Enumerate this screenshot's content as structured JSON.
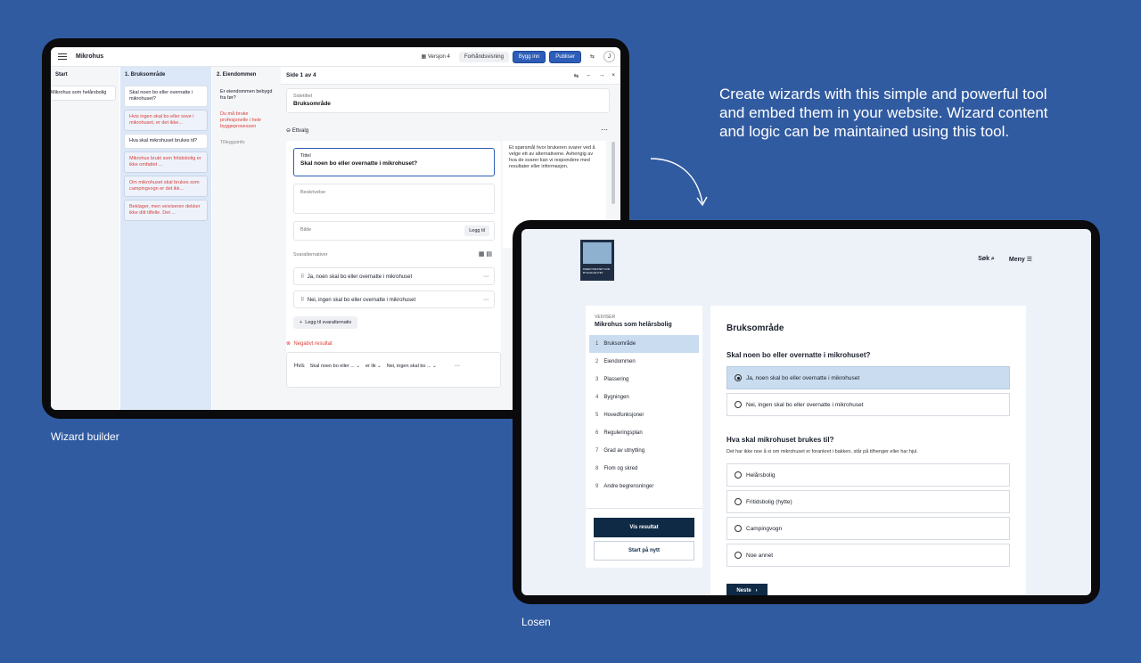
{
  "marketing_text": "Create wizards with this simple and powerful tool and embed them in your website. Wizard content and logic can be maintained using this tool.",
  "captions": {
    "builder": "Wizard builder",
    "losen": "Losen"
  },
  "builder": {
    "title": "Mikrohus",
    "version": "Versjon 4",
    "preview": "Forhåndsvisning",
    "embed": "Bygg inn",
    "publish": "Publiser",
    "avatar": "J",
    "col_start": {
      "head": "Start",
      "cards": [
        "Mikrohus som helårsbolig"
      ]
    },
    "col_bruk": {
      "head": "1.  Bruksområde",
      "cards": [
        {
          "text": "Skal noen bo eller overnatte i mikrohuset?",
          "type": "normal"
        },
        {
          "text": "Hvis ingen skal bo eller sove i mikrohuset, er det ikke...",
          "type": "red"
        },
        {
          "text": "Hva skal mikrohuset brukes til?",
          "type": "normal"
        },
        {
          "text": "Mikrohus brukt som fritidsbolig er ikke omfattet ...",
          "type": "red"
        },
        {
          "text": "Om mikrohuset skal brukes som campingvogn er det ikk...",
          "type": "red"
        },
        {
          "text": "Beklager, men veiviseren dekker ikke ditt tilfelle. Det ...",
          "type": "red"
        }
      ]
    },
    "col_eiend": {
      "head": "2.  Eiendommen",
      "cards": [
        {
          "text": "Er eiendommen bebygd fra før?",
          "type": "normal"
        },
        {
          "text": "Du må bruke profesjonelle i hele byggeprosessen",
          "type": "red"
        },
        {
          "text": "Tilleggsinfo",
          "type": "dim"
        }
      ]
    },
    "panel": {
      "page": "Side 1 av 4",
      "page_title_label": "Sidetittel",
      "page_title": "Bruksområde",
      "block": "Ettvalg",
      "title_label": "Tittel",
      "title_value": "Skal noen bo eller overnatte i mikrohuset?",
      "desc_placeholder": "Beskrivelse",
      "image_label": "Bilde",
      "image_add": "Legg til",
      "answers_label": "Svaralternativer",
      "answers": [
        "Ja, noen skal bo eller overnatte i mikrohuset",
        "Nei, ingen skal bo eller overnatte i mikrohuset"
      ],
      "add_answer": "Legg til svaralternativ",
      "help": "Et spørsmål hvor brukeren svarer ved å velge ett av alternativene. Avhengig av hva de svarer kan vi respondere med resultater eller informasjon.",
      "negative": "Negativt resultat",
      "if": "Hvis",
      "cond_q": "Skal noen bo eller ...",
      "cond_op": "er lik",
      "cond_v": "Nei, ingen skal bo ..."
    }
  },
  "losen": {
    "search": "Søk",
    "menu": "Meny",
    "logo_text": "DIREKTORATET FOR BYGGKVALITET",
    "guide_small": "VEIVISER",
    "guide_name": "Mikrohus som helårsbolig",
    "steps": [
      {
        "n": "1",
        "label": "Bruksområde"
      },
      {
        "n": "2",
        "label": "Eiendommen"
      },
      {
        "n": "3",
        "label": "Plassering"
      },
      {
        "n": "4",
        "label": "Bygningen"
      },
      {
        "n": "5",
        "label": "Hovedfunksjoner"
      },
      {
        "n": "6",
        "label": "Reguleringsplan"
      },
      {
        "n": "7",
        "label": "Grad av utnytting"
      },
      {
        "n": "8",
        "label": "Flom og skred"
      },
      {
        "n": "9",
        "label": "Andre begrensninger"
      }
    ],
    "show_result": "Vis resultat",
    "restart": "Start på nytt",
    "heading": "Bruksområde",
    "q1": "Skal noen bo eller overnatte i mikrohuset?",
    "q1_opts": [
      "Ja, noen skal bo eller overnatte i mikrohuset",
      "Nei, ingen skal bo eller overnatte i mikrohuset"
    ],
    "q2": "Hva skal mikrohuset brukes til?",
    "q2_help": "Det har ikke noe å si om mikrohuset er forankret i bakken, står på tilhenger eller har hjul.",
    "q2_opts": [
      "Helårsbolig",
      "Fritidsbolig (hytte)",
      "Campingvogn",
      "Noe annet"
    ],
    "next": "Neste"
  }
}
